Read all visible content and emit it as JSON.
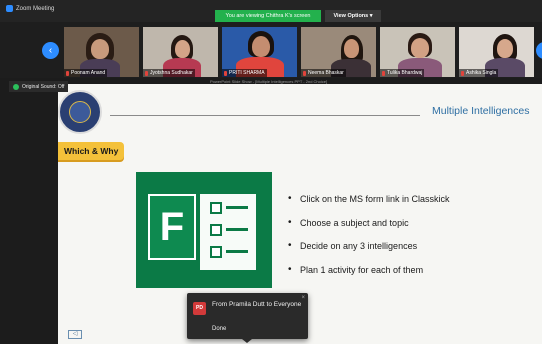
{
  "window": {
    "title": "Zoom Meeting"
  },
  "banner": {
    "viewing_text": "You are viewing Chithra K's screen",
    "view_options_label": "View Options ▾"
  },
  "participants": [
    {
      "name": "Poonam Anand"
    },
    {
      "name": "Jyotshna Sudhakar"
    },
    {
      "name": "PRITI SHARMA"
    },
    {
      "name": "Neema Bhaskar"
    },
    {
      "name": "Tulika Bhardwaj"
    },
    {
      "name": "Ashika Singla"
    }
  ],
  "share": {
    "caption": "PowerPoint Slide Show - [Multiple Intelligences PPT - 2nd Choice]",
    "original_sound_label": "Original Sound: Off"
  },
  "slide": {
    "title": "Multiple Intelligences",
    "tag": "Which & Why",
    "app_letter": "F",
    "bullets": [
      "Click on the MS form link in Classkick",
      "Choose a subject and topic",
      "Decide on any 3 intelligences",
      "Plan 1 activity for each of them"
    ]
  },
  "chat": {
    "avatar_initials": "PD",
    "from": "From Pramila Dutt to Everyone",
    "message": "Done",
    "close_glyph": "×"
  },
  "icons": {
    "nav_left": "‹",
    "nav_right": "›",
    "slide_corner": "◁"
  },
  "colors": {
    "accent": "#2d8cff",
    "banner": "#23b14d",
    "forms_green": "#0b7a46",
    "tag_yellow": "#f4c13a"
  }
}
